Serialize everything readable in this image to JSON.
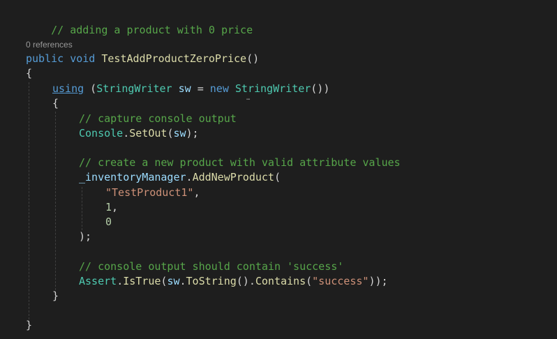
{
  "editor": {
    "header_comment": "// adding a product with 0 price",
    "codelens": "0 references",
    "method": {
      "modifier": "public",
      "return_type": "void",
      "name": "TestAddProductZeroPrice",
      "params": "()"
    },
    "open_brace": "{",
    "using_line": {
      "keyword": "using",
      "open_paren": " (",
      "type": "StringWriter",
      "var": " sw",
      "assign": " = ",
      "new_kw": "new",
      "space": " ",
      "ctor": "StringWriter",
      "close": "())"
    },
    "inner_open": "{",
    "comment1": "// capture console output",
    "setout_line": {
      "cls": "Console",
      "dot": ".",
      "method": "SetOut",
      "arg_open": "(",
      "arg": "sw",
      "arg_close": ");"
    },
    "comment2": "// create a new product with valid attribute values",
    "add_line": {
      "field": "_inventoryManager",
      "dot": ".",
      "method": "AddNewProduct",
      "paren": "("
    },
    "arg1": "\"TestProduct1\"",
    "arg1_comma": ",",
    "arg2": "1",
    "arg2_comma": ",",
    "arg3": "0",
    "add_close": ");",
    "comment3": "// console output should contain 'success'",
    "assert_line": {
      "cls": "Assert",
      "dot1": ".",
      "method": "IsTrue",
      "p1": "(",
      "var": "sw",
      "dot2": ".",
      "tostring": "ToString",
      "p2": "().",
      "contains": "Contains",
      "p3": "(",
      "str": "\"success\"",
      "p4": "));"
    },
    "inner_close": "}",
    "close_brace": "}"
  }
}
